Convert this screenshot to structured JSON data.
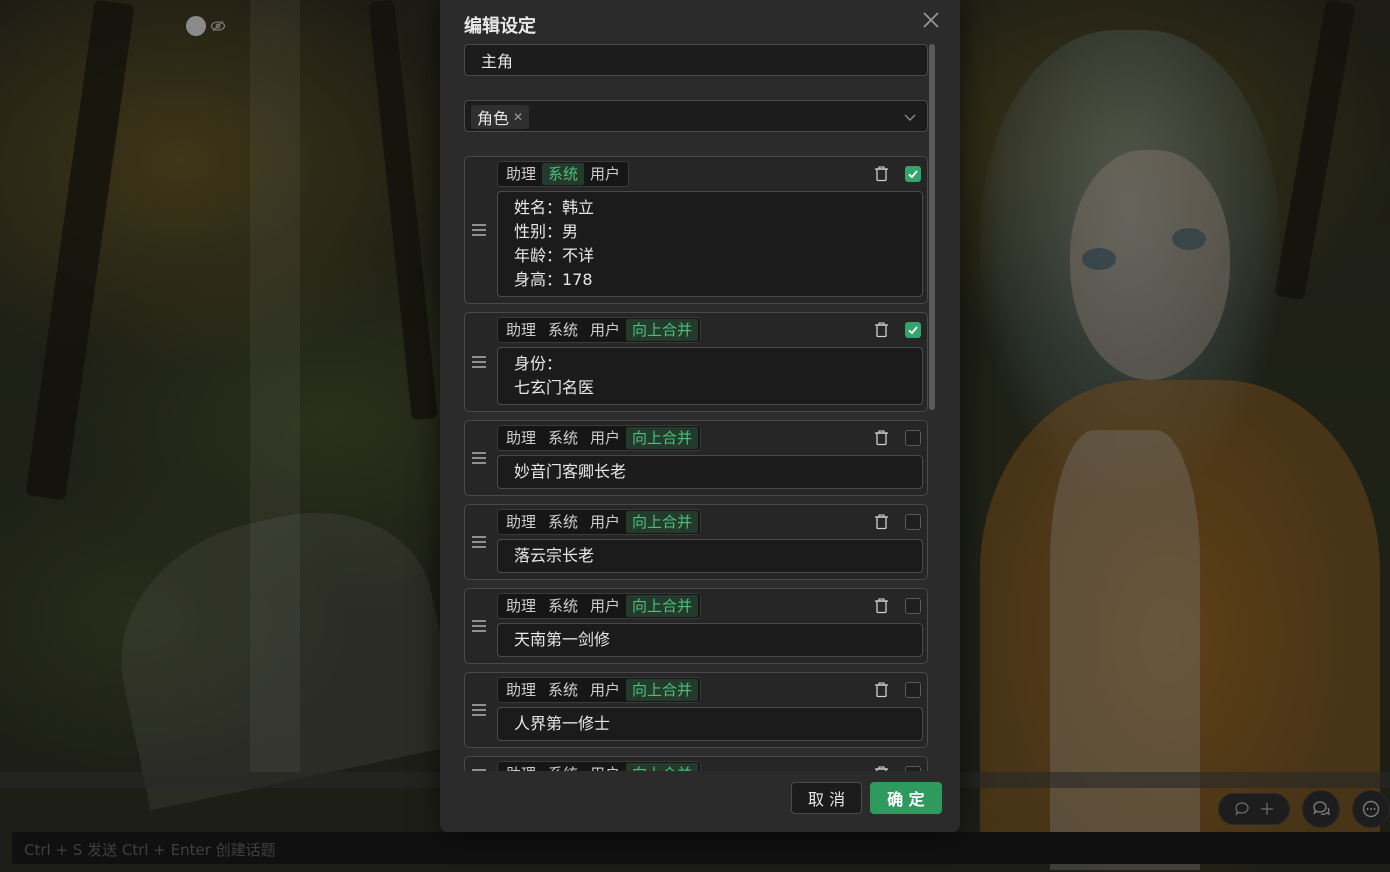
{
  "background": {
    "input_placeholder": "Ctrl + S 发送    Ctrl + Enter 创建话题"
  },
  "modal": {
    "title": "编辑设定",
    "name_value": "主角",
    "tags": [
      "角色"
    ],
    "role_labels": [
      "助理",
      "系统",
      "用户"
    ],
    "merge_label": "向上合并",
    "cards": [
      {
        "active_role": 1,
        "show_merge": false,
        "checked": true,
        "lines": [
          "姓名：韩立",
          "性别：男",
          "年龄：不详",
          "身高：178"
        ]
      },
      {
        "active_role": -1,
        "show_merge": true,
        "checked": true,
        "lines": [
          "身份：",
          "七玄门名医"
        ]
      },
      {
        "active_role": -1,
        "show_merge": true,
        "checked": false,
        "lines": [
          "妙音门客卿长老"
        ]
      },
      {
        "active_role": -1,
        "show_merge": true,
        "checked": false,
        "lines": [
          "落云宗长老"
        ]
      },
      {
        "active_role": -1,
        "show_merge": true,
        "checked": false,
        "lines": [
          "天南第一剑修"
        ]
      },
      {
        "active_role": -1,
        "show_merge": true,
        "checked": false,
        "lines": [
          "人界第一修士"
        ]
      },
      {
        "active_role": -1,
        "show_merge": true,
        "checked": false,
        "lines": [
          ""
        ]
      }
    ],
    "cancel_label": "取 消",
    "ok_label": "确 定"
  },
  "colors": {
    "accent_green": "#34a56a",
    "active_role_text": "#4fbf7a"
  }
}
